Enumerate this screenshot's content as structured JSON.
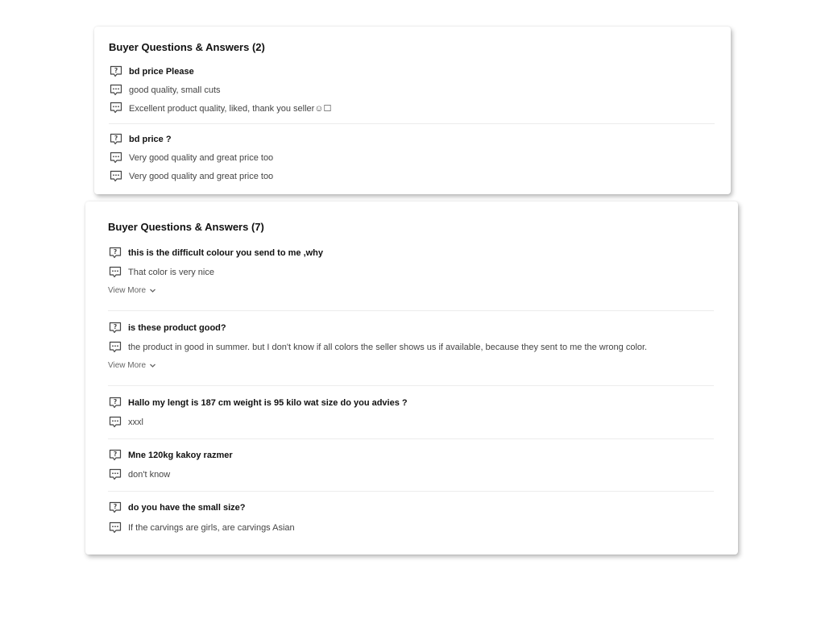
{
  "card1": {
    "title": "Buyer Questions & Answers (2)",
    "groups": [
      {
        "question": "bd price Please",
        "answers": [
          "good quality, small cuts",
          "Excellent product quality, liked, thank you seller☺☐"
        ]
      },
      {
        "question": "bd price ?",
        "answers": [
          "Very good quality and great price too",
          "Very good quality and great price too"
        ]
      }
    ]
  },
  "card2": {
    "title": "Buyer Questions & Answers (7)",
    "view_more_label": "View More",
    "groups": [
      {
        "question": "this is the difficult colour you send to me ,why",
        "answers": [
          "That color is very nice"
        ]
      },
      {
        "question": "is these product good?",
        "answers": [
          "the product in good in summer. but I don't know if all colors the seller shows us if available, because they sent to me the wrong color."
        ]
      },
      {
        "question": "Hallo my lengt is 187 cm weight is 95 kilo wat size do you advies ?",
        "answers": [
          "xxxl"
        ]
      },
      {
        "question": "Mne 120kg kakoy razmer",
        "answers": [
          "don't know"
        ]
      },
      {
        "question": "do you have the small size?",
        "answers": [
          "If the carvings are girls, are carvings Asian"
        ]
      }
    ]
  },
  "icons": {
    "question": "question-icon",
    "answer": "answer-icon",
    "chevron": "chevron-down-icon"
  }
}
